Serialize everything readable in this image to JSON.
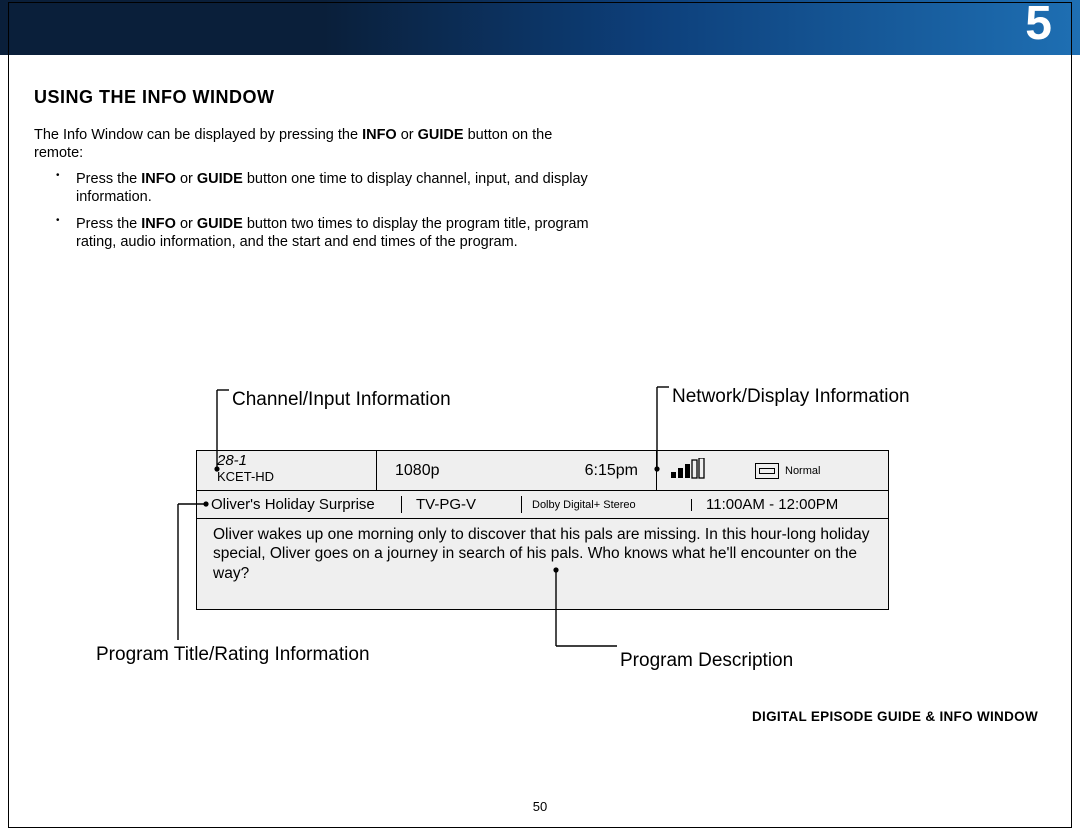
{
  "chapter_number": "5",
  "section_title": "USING THE INFO WINDOW",
  "intro": {
    "pre": "The Info Window can be displayed by pressing the ",
    "bold1": "INFO",
    "mid1": " or ",
    "bold2": "GUIDE",
    "post": " button on the remote:"
  },
  "bullets": [
    {
      "pre": "Press the ",
      "b1": "INFO",
      "mid": " or ",
      "b2": "GUIDE",
      "post": " button one time to display channel, input, and display information."
    },
    {
      "pre": "Press the ",
      "b1": "INFO",
      "mid": " or ",
      "b2": "GUIDE",
      "post": " button two times to display the program title, program rating, audio information, and the start and end times of the program."
    }
  ],
  "callouts": {
    "channel_input": "Channel/Input Information",
    "network_display": "Network/Display Information",
    "program_title_rating": "Program Title/Rating Information",
    "program_description": "Program Description"
  },
  "info_window": {
    "channel_number": "28-1",
    "channel_name": "KCET-HD",
    "resolution": "1080p",
    "time": "6:15pm",
    "aspect_label": "Normal",
    "program_title": "Oliver's Holiday Surprise",
    "rating": "TV-PG-V",
    "audio": "Dolby Digital+ Stereo",
    "program_time": "11:00AM - 12:00PM",
    "description": "Oliver wakes up one morning only to discover that his pals are missing. In this hour-long holiday special, Oliver goes on a journey in search of his pals. Who knows what he'll encounter on the way?"
  },
  "footer_label": "DIGITAL EPISODE GUIDE & INFO WINDOW",
  "page_number": "50"
}
